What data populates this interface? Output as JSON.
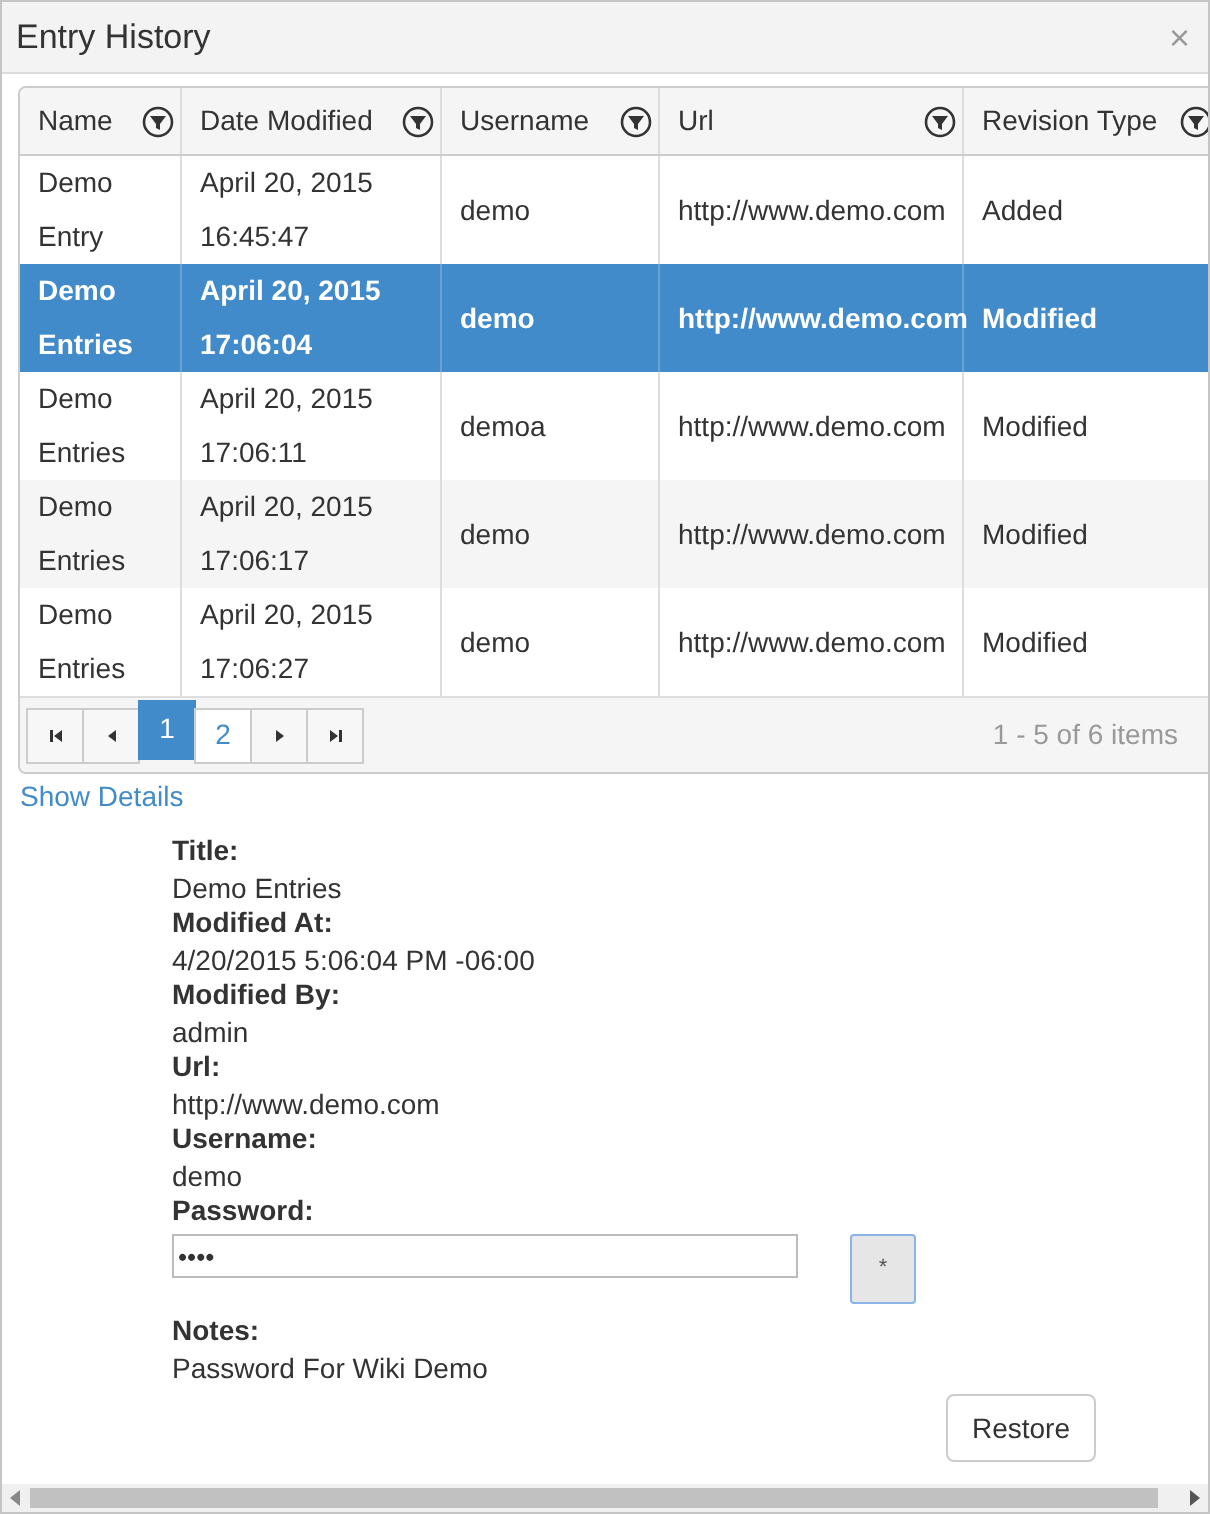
{
  "window": {
    "title": "Entry History",
    "close": "×"
  },
  "table": {
    "columns": [
      {
        "label": "Name"
      },
      {
        "label": "Date Modified"
      },
      {
        "label": "Username"
      },
      {
        "label": "Url"
      },
      {
        "label": "Revision Type"
      }
    ],
    "rows": [
      {
        "name": "Demo Entry",
        "date": "April 20, 2015 16:45:47",
        "username": "demo",
        "url": "http://www.demo.com",
        "revision_type": "Added",
        "selected": false
      },
      {
        "name": "Demo Entries",
        "date": "April 20, 2015 17:06:04",
        "username": "demo",
        "url": "http://www.demo.com",
        "revision_type": "Modified",
        "selected": true
      },
      {
        "name": "Demo Entries",
        "date": "April 20, 2015 17:06:11",
        "username": "demoa",
        "url": "http://www.demo.com",
        "revision_type": "Modified",
        "selected": false
      },
      {
        "name": "Demo Entries",
        "date": "April 20, 2015 17:06:17",
        "username": "demo",
        "url": "http://www.demo.com",
        "revision_type": "Modified",
        "selected": false
      },
      {
        "name": "Demo Entries",
        "date": "April 20, 2015 17:06:27",
        "username": "demo",
        "url": "http://www.demo.com",
        "revision_type": "Modified",
        "selected": false
      }
    ]
  },
  "pager": {
    "pages": [
      {
        "label": "1",
        "selected": true
      },
      {
        "label": "2",
        "selected": false
      }
    ],
    "summary": "1 - 5 of 6 items"
  },
  "show_details": "Show Details",
  "details": [
    {
      "label": "Title:",
      "value": "Demo Entries",
      "kind": "text"
    },
    {
      "label": "Modified At:",
      "value": "4/20/2015 5:06:04 PM -06:00",
      "kind": "text"
    },
    {
      "label": "Modified By:",
      "value": "admin",
      "kind": "text"
    },
    {
      "label": "Url:",
      "value": "http://www.demo.com",
      "kind": "text"
    },
    {
      "label": "Username:",
      "value": "demo",
      "kind": "text"
    },
    {
      "label": "Password:",
      "value": "••••",
      "kind": "password",
      "button": "*"
    },
    {
      "label": "Notes:",
      "value": "Password For Wiki Demo",
      "kind": "text"
    }
  ],
  "restore_button": "Restore"
}
